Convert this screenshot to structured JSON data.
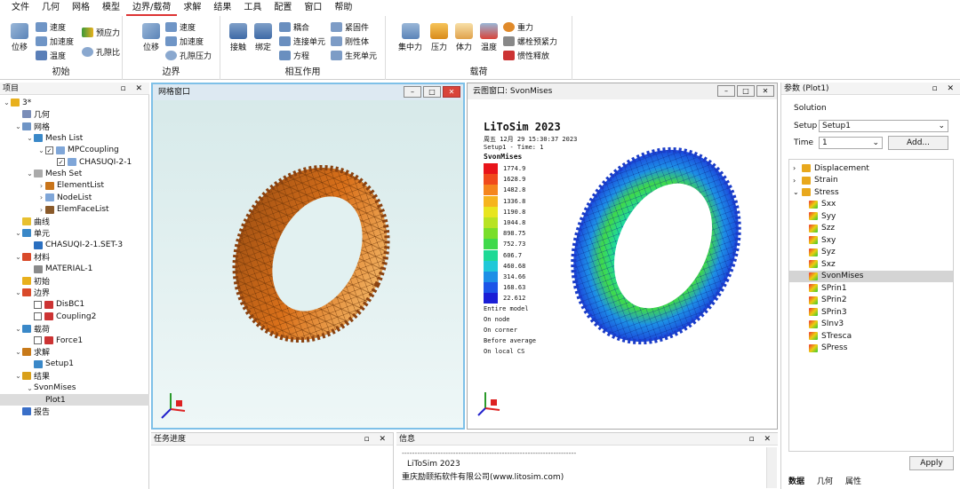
{
  "menu": [
    "文件",
    "几何",
    "网格",
    "模型",
    "边界/载荷",
    "求解",
    "结果",
    "工具",
    "配置",
    "窗口",
    "帮助"
  ],
  "ribbon": {
    "initial": {
      "title": "初始",
      "big": "位移",
      "items": [
        "速度",
        "加速度",
        "温度",
        "预应力",
        "孔隙比"
      ]
    },
    "boundary": {
      "title": "边界",
      "big": "位移",
      "items": [
        "速度",
        "加速度",
        "孔隙压力"
      ]
    },
    "interaction": {
      "title": "相互作用",
      "big1": "接触",
      "big2": "绑定",
      "items": [
        "耦合",
        "连接单元",
        "方程",
        "紧固件",
        "刚性体",
        "生死单元"
      ]
    },
    "load": {
      "title": "载荷",
      "items": [
        "集中力",
        "压力",
        "体力",
        "温度",
        "重力",
        "螺栓预紧力",
        "惯性释放"
      ]
    }
  },
  "project": {
    "title": "项目",
    "items": [
      {
        "label": "3*"
      },
      {
        "label": "几何"
      },
      {
        "label": "网格"
      },
      {
        "label": "Mesh List"
      },
      {
        "label": "MPCcoupling"
      },
      {
        "label": "CHASUQI-2-1"
      },
      {
        "label": "Mesh Set"
      },
      {
        "label": "ElementList"
      },
      {
        "label": "NodeList"
      },
      {
        "label": "ElemFaceList"
      },
      {
        "label": "曲线"
      },
      {
        "label": "单元"
      },
      {
        "label": "CHASUQI-2-1.SET-3"
      },
      {
        "label": "材料"
      },
      {
        "label": "MATERIAL-1"
      },
      {
        "label": "初始"
      },
      {
        "label": "边界"
      },
      {
        "label": "DisBC1"
      },
      {
        "label": "Coupling2"
      },
      {
        "label": "载荷"
      },
      {
        "label": "Force1"
      },
      {
        "label": "求解"
      },
      {
        "label": "Setup1"
      },
      {
        "label": "结果"
      },
      {
        "label": "SvonMises"
      },
      {
        "label": "Plot1"
      },
      {
        "label": "报告"
      }
    ]
  },
  "mesh_window": {
    "title": "网格窗口"
  },
  "cloud_window": {
    "title": "云图窗口: SvonMises",
    "app": "LiToSim 2023",
    "date": "周五 12月 29 15:30:37 2023",
    "setup": "Setup1 -    Time: 1",
    "var": "SvonMises",
    "legend": [
      "1774.9",
      "1628.9",
      "1482.8",
      "1336.8",
      "1190.8",
      "1044.8",
      "898.75",
      "752.73",
      "606.7",
      "460.68",
      "314.66",
      "168.63",
      "22.612"
    ],
    "legend_colors": [
      "#e8141a",
      "#f04a1c",
      "#f5851d",
      "#f6b41e",
      "#e8e51f",
      "#b8e323",
      "#79de2a",
      "#3fd94b",
      "#1ed995",
      "#20c8d8",
      "#1d8fe6",
      "#1c55e8",
      "#1a1ed6"
    ],
    "notes": [
      "Entire model",
      "On node",
      "On corner",
      "Before average",
      "On local CS"
    ]
  },
  "params": {
    "title": "参数 (Plot1)",
    "solution": "Solution",
    "setup_label": "Setup",
    "setup_value": "Setup1",
    "time_label": "Time",
    "time_value": "1",
    "add_btn": "Add...",
    "tree": [
      {
        "label": "Displacement"
      },
      {
        "label": "Strain"
      },
      {
        "label": "Stress"
      },
      {
        "label": "Sxx"
      },
      {
        "label": "Syy"
      },
      {
        "label": "Szz"
      },
      {
        "label": "Sxy"
      },
      {
        "label": "Syz"
      },
      {
        "label": "Sxz"
      },
      {
        "label": "SvonMises"
      },
      {
        "label": "SPrin1"
      },
      {
        "label": "SPrin2"
      },
      {
        "label": "SPrin3"
      },
      {
        "label": "SInv3"
      },
      {
        "label": "STresca"
      },
      {
        "label": "SPress"
      }
    ],
    "apply": "Apply",
    "tabs": [
      "数据",
      "几何",
      "属性"
    ]
  },
  "task": {
    "title": "任务进度"
  },
  "info": {
    "title": "信息",
    "dashes": "--------------------------------------------------------------------",
    "line1": "LiToSim 2023",
    "line2": "重庆励颐拓软件有限公司(www.litosim.com)"
  },
  "colors": {
    "gear": "#d9701a",
    "accent": "#d33"
  }
}
